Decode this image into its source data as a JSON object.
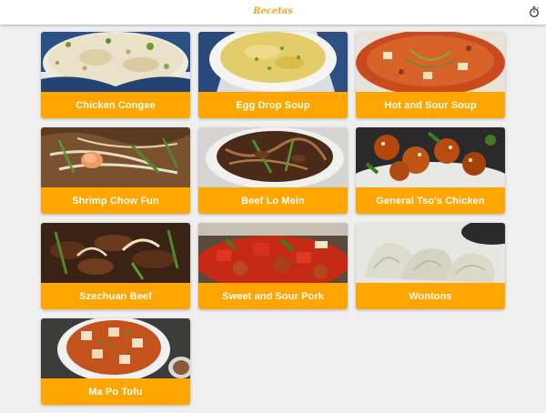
{
  "app": {
    "title": "Recetas",
    "timer_icon": "timer-icon",
    "accent_color": "#ffa500",
    "title_color": "#f5a623"
  },
  "recipes": [
    {
      "name": "Chicken Congee",
      "photo": "congee-photo"
    },
    {
      "name": "Egg Drop Soup",
      "photo": "egg-drop-soup-photo"
    },
    {
      "name": "Hot and Sour Soup",
      "photo": "hot-and-sour-soup-photo"
    },
    {
      "name": "Shrimp Chow Fun",
      "photo": "shrimp-chow-fun-photo"
    },
    {
      "name": "Beef Lo Mein",
      "photo": "beef-lo-mein-photo"
    },
    {
      "name": "General Tso's Chicken",
      "photo": "general-tsos-chicken-photo"
    },
    {
      "name": "Szechuan Beef",
      "photo": "szechuan-beef-photo"
    },
    {
      "name": "Sweet and Sour Pork",
      "photo": "sweet-and-sour-pork-photo"
    },
    {
      "name": "Wontons",
      "photo": "wontons-photo"
    },
    {
      "name": "Ma Po Tofu",
      "photo": "ma-po-tofu-photo"
    }
  ]
}
